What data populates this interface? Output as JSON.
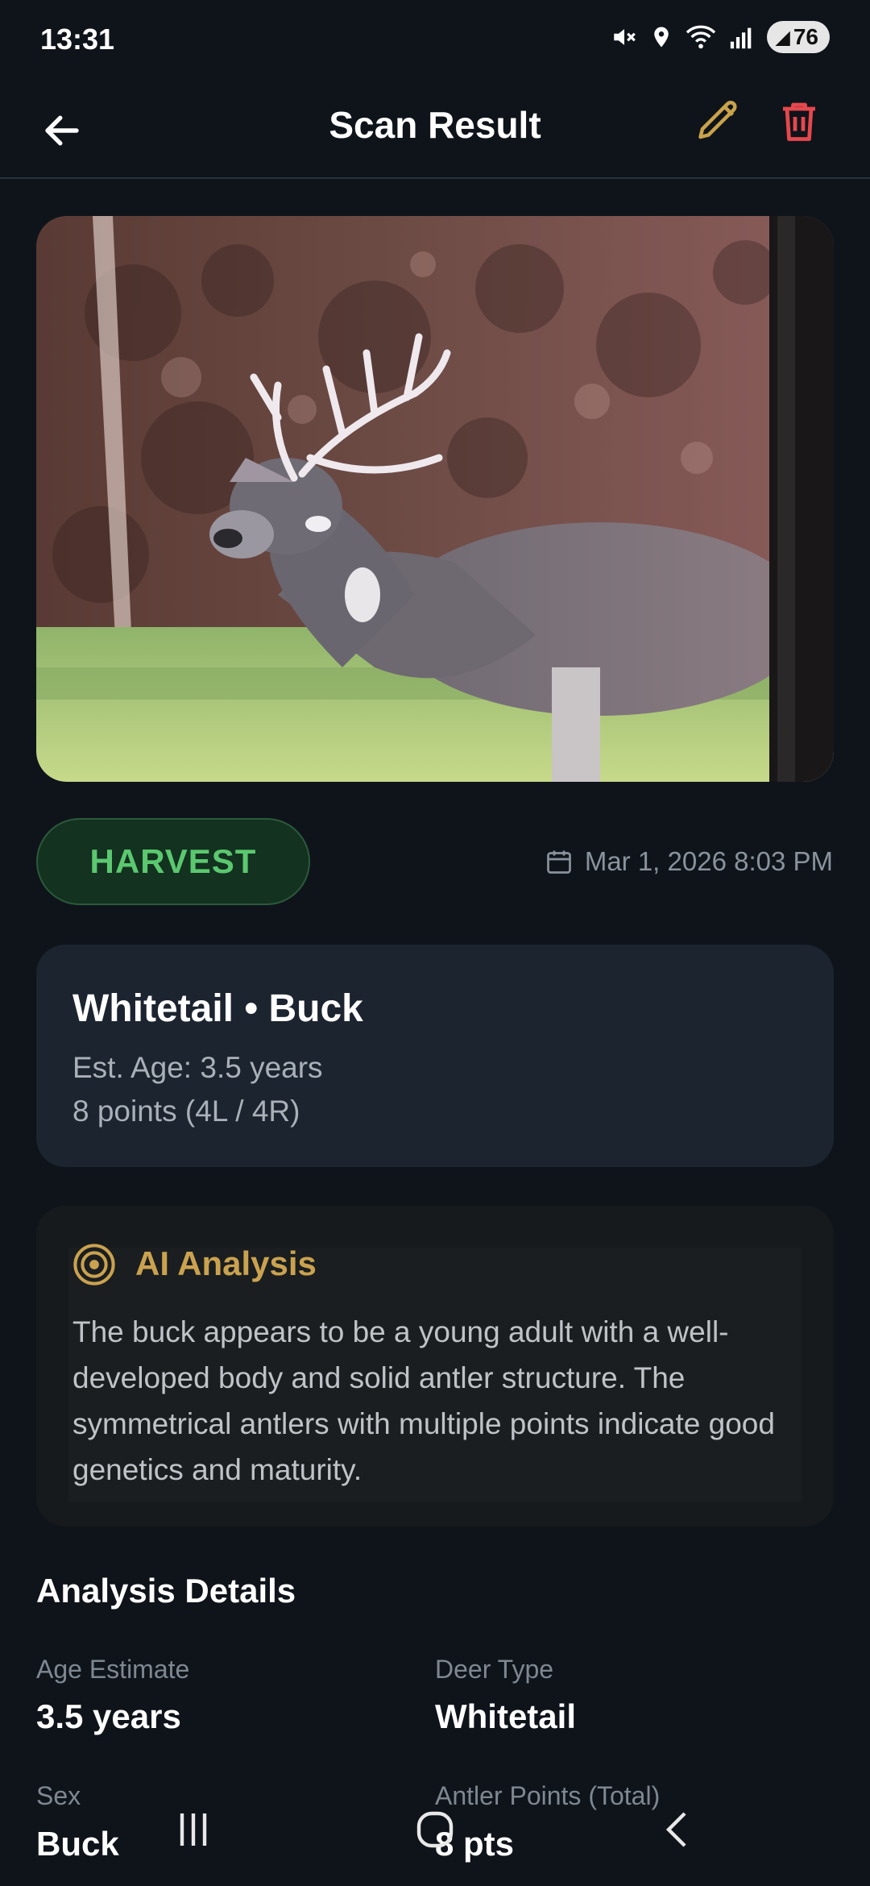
{
  "status_bar": {
    "time": "13:31",
    "battery": "76",
    "icons": [
      "mute-icon",
      "location-icon",
      "wifi-icon",
      "signal-icon",
      "battery-icon"
    ]
  },
  "header": {
    "title": "Scan Result",
    "back_icon": "arrow-left-icon",
    "edit_icon": "pencil-icon",
    "delete_icon": "trash-icon"
  },
  "result": {
    "badge": "HARVEST",
    "date": "Mar 1, 2026 8:03 PM",
    "title": "Whitetail • Buck",
    "age_line": "Est. Age: 3.5 years",
    "points_line": "8 points (4L / 4R)"
  },
  "ai_analysis": {
    "title": "AI Analysis",
    "text": "The buck appears to be a young adult with a well-developed body and solid antler structure. The symmetrical antlers with multiple points indicate good genetics and maturity."
  },
  "details": {
    "title": "Analysis Details",
    "items": [
      {
        "label": "Age Estimate",
        "value": "3.5 years"
      },
      {
        "label": "Deer Type",
        "value": "Whitetail"
      },
      {
        "label": "Sex",
        "value": "Buck"
      },
      {
        "label": "Antler Points (Total)",
        "value": "8 pts"
      }
    ]
  },
  "colors": {
    "background": "#0f141b",
    "card": "#1c2430",
    "harvest_green": "#5bc870",
    "ai_gold": "#caa24f",
    "edit_gold": "#c9a24a",
    "delete_red": "#e5484d"
  }
}
